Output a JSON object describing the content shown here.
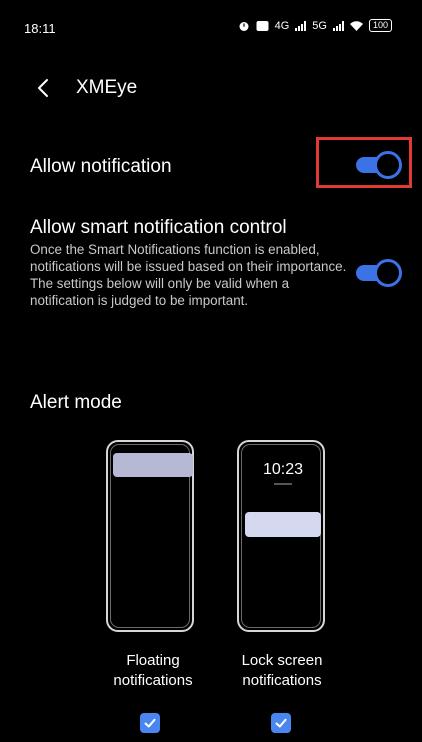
{
  "status_bar": {
    "time": "18:11",
    "network_1": "4G",
    "network_2": "5G",
    "battery": "100"
  },
  "header": {
    "title": "XMEye"
  },
  "settings": {
    "allow_notification": {
      "label": "Allow notification",
      "enabled": true
    },
    "smart_notification": {
      "label": "Allow smart notification control",
      "description": "Once the Smart Notifications function is enabled, notifications will be issued based on their importance. The settings below will only be valid when a notification is judged to be important.",
      "enabled": true
    }
  },
  "alert_mode": {
    "label": "Alert mode",
    "options": [
      {
        "caption_line1": "Floating",
        "caption_line2": "notifications",
        "checked": true
      },
      {
        "caption_line1": "Lock screen",
        "caption_line2": "notifications",
        "lock_time": "10:23",
        "checked": true
      }
    ]
  },
  "colors": {
    "accent": "#3b72e6",
    "highlight": "#e23b35",
    "background": "#000000"
  }
}
